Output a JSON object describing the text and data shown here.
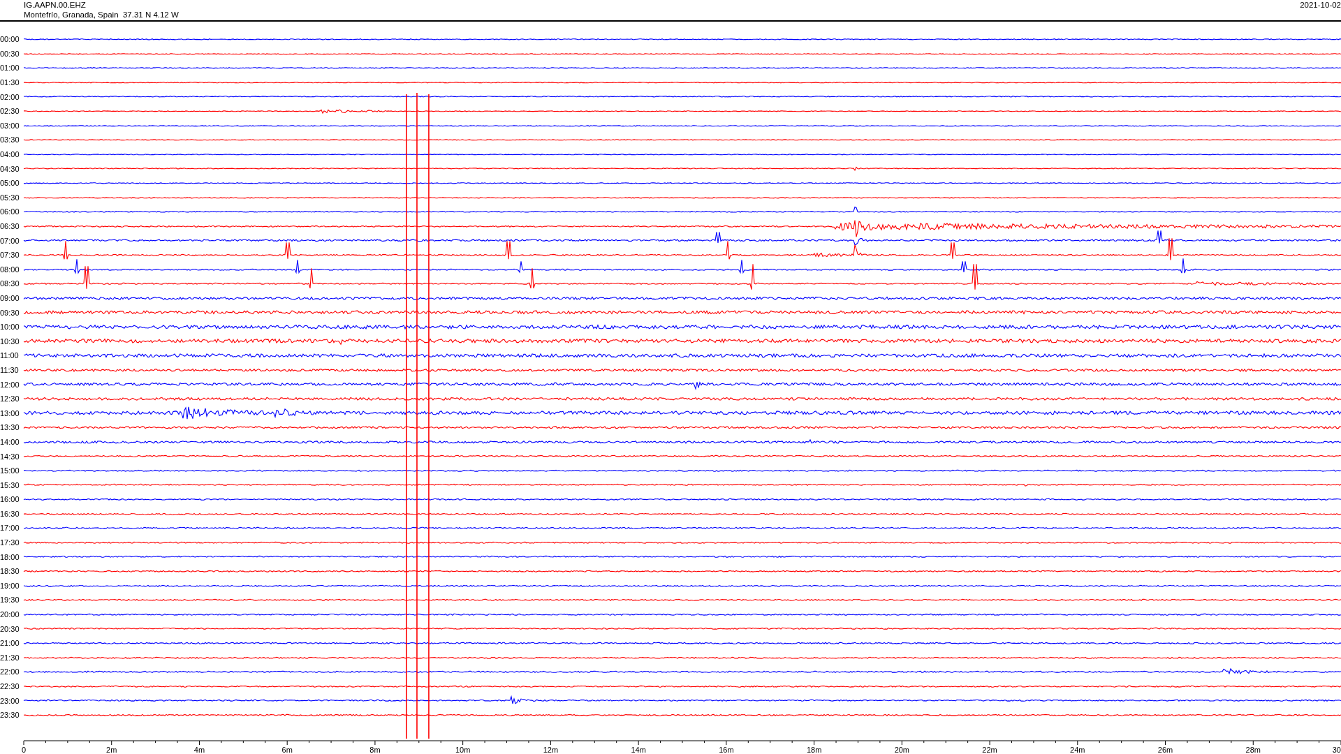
{
  "header": {
    "station": "IG.AAPN.00.EHZ",
    "location": "Montefrío, Granada, Spain  37.31 N 4.12 W",
    "date": "2021-10-02"
  },
  "rows": [
    {
      "label": "00:00",
      "color": "#0000ff"
    },
    {
      "label": "00:30",
      "color": "#ff0000"
    },
    {
      "label": "01:00",
      "color": "#0000ff"
    },
    {
      "label": "01:30",
      "color": "#ff0000"
    },
    {
      "label": "02:00",
      "color": "#0000ff"
    },
    {
      "label": "02:30",
      "color": "#ff0000"
    },
    {
      "label": "03:00",
      "color": "#0000ff"
    },
    {
      "label": "03:30",
      "color": "#ff0000"
    },
    {
      "label": "04:00",
      "color": "#0000ff"
    },
    {
      "label": "04:30",
      "color": "#ff0000"
    },
    {
      "label": "05:00",
      "color": "#0000ff"
    },
    {
      "label": "05:30",
      "color": "#ff0000"
    },
    {
      "label": "06:00",
      "color": "#0000ff"
    },
    {
      "label": "06:30",
      "color": "#ff0000"
    },
    {
      "label": "07:00",
      "color": "#0000ff"
    },
    {
      "label": "07:30",
      "color": "#ff0000"
    },
    {
      "label": "08:00",
      "color": "#0000ff"
    },
    {
      "label": "08:30",
      "color": "#ff0000"
    },
    {
      "label": "09:00",
      "color": "#0000ff"
    },
    {
      "label": "09:30",
      "color": "#ff0000"
    },
    {
      "label": "10:00",
      "color": "#0000ff"
    },
    {
      "label": "10:30",
      "color": "#ff0000"
    },
    {
      "label": "11:00",
      "color": "#0000ff"
    },
    {
      "label": "11:30",
      "color": "#ff0000"
    },
    {
      "label": "12:00",
      "color": "#0000ff"
    },
    {
      "label": "12:30",
      "color": "#ff0000"
    },
    {
      "label": "13:00",
      "color": "#0000ff"
    },
    {
      "label": "13:30",
      "color": "#ff0000"
    },
    {
      "label": "14:00",
      "color": "#0000ff"
    },
    {
      "label": "14:30",
      "color": "#ff0000"
    },
    {
      "label": "15:00",
      "color": "#0000ff"
    },
    {
      "label": "15:30",
      "color": "#ff0000"
    },
    {
      "label": "16:00",
      "color": "#0000ff"
    },
    {
      "label": "16:30",
      "color": "#ff0000"
    },
    {
      "label": "17:00",
      "color": "#0000ff"
    },
    {
      "label": "17:30",
      "color": "#ff0000"
    },
    {
      "label": "18:00",
      "color": "#0000ff"
    },
    {
      "label": "18:30",
      "color": "#ff0000"
    },
    {
      "label": "19:00",
      "color": "#0000ff"
    },
    {
      "label": "19:30",
      "color": "#ff0000"
    },
    {
      "label": "20:00",
      "color": "#0000ff"
    },
    {
      "label": "20:30",
      "color": "#ff0000"
    },
    {
      "label": "21:00",
      "color": "#0000ff"
    },
    {
      "label": "21:30",
      "color": "#ff0000"
    },
    {
      "label": "22:00",
      "color": "#0000ff"
    },
    {
      "label": "22:30",
      "color": "#ff0000"
    },
    {
      "label": "23:00",
      "color": "#0000ff"
    },
    {
      "label": "23:30",
      "color": "#ff0000"
    }
  ],
  "x_axis": {
    "labels": [
      "0",
      "2m",
      "4m",
      "6m",
      "8m",
      "10m",
      "12m",
      "14m",
      "16m",
      "18m",
      "20m",
      "22m",
      "24m",
      "26m",
      "28m",
      "30"
    ]
  }
}
